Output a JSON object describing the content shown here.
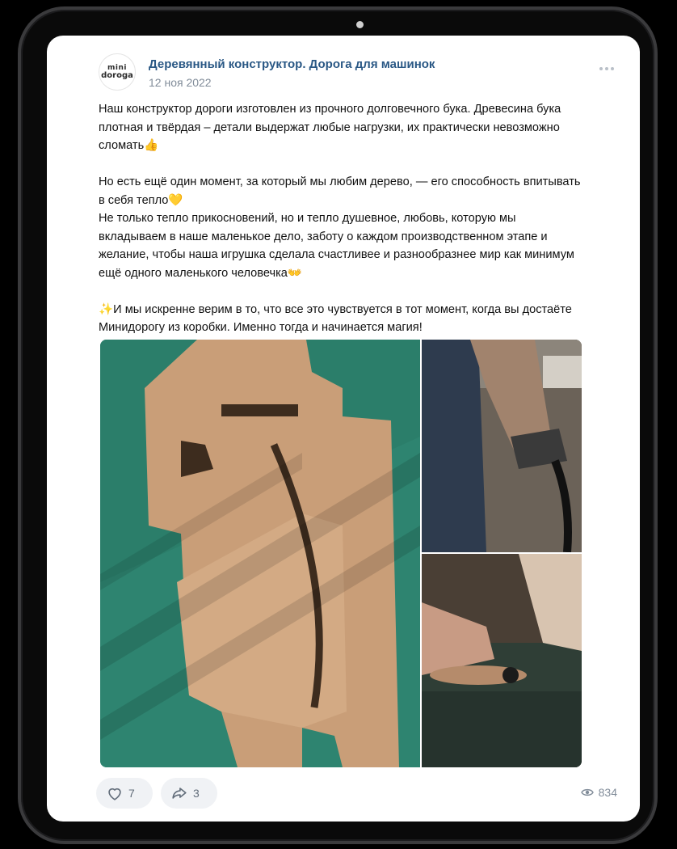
{
  "post": {
    "avatar_line1": "mini",
    "avatar_line2": "doroga",
    "author": "Деревянный конструктор. Дорога для машинок",
    "date": "12 ноя 2022",
    "paragraphs": [
      "Наш конструктор дороги изготовлен из прочного долговечного бука. Древесина бука плотная и твёрдая – детали выдержат любые нагрузки, их практически невозможно сломать👍",
      "Но есть ещё один момент, за который мы любим дерево, — его способность впитывать в себя тепло💛",
      "Не только тепло прикосновений, но и тепло душевное, любовь, которую мы вкладываем в наше маленькое дело, заботу о каждом производственном этапе и желание, чтобы наша игрушка сделала счастливее и разнообразнее мир как минимум ещё одного маленького человечка👐",
      "✨И мы искренне верим в то, что все это чувствуется в тот момент, когда вы достаёте Минидорогу из коробки. Именно тогда и начинается магия!"
    ]
  },
  "gallery": {
    "photos": [
      {
        "description": "wooden-road-pieces-on-green",
        "color": "#2f8a74"
      },
      {
        "description": "worker-sanding-wood",
        "color": "#4b4a46"
      },
      {
        "description": "hand-cutting-wood-piece",
        "color": "#3e3e3a"
      }
    ]
  },
  "actions": {
    "likes": "7",
    "shares": "3",
    "views": "834"
  },
  "colors": {
    "link": "#2a5885",
    "muted": "#818c99",
    "pill_bg": "#f0f2f5"
  },
  "icons": [
    "more-icon",
    "heart-icon",
    "share-icon",
    "eye-icon"
  ]
}
